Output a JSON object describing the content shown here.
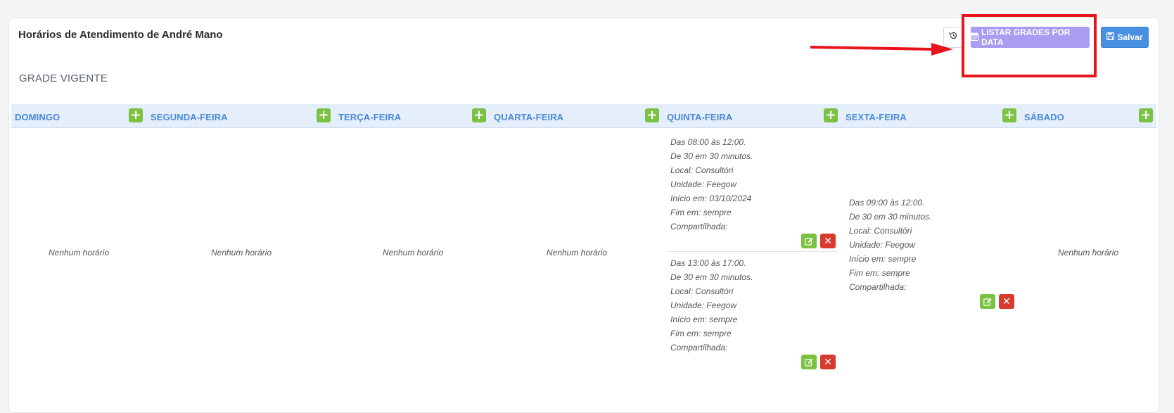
{
  "page": {
    "title": "Horários de Atendimento de André Mano",
    "section_title": "GRADE VIGENTE"
  },
  "toolbar": {
    "history_icon": "history-icon",
    "list_label": "LISTAR GRADES POR DATA",
    "list_icon": "calendar-icon",
    "save_label": "Salvar",
    "save_icon": "floppy-disk-icon"
  },
  "colors": {
    "list_button": "#a99cf2",
    "save_button": "#4a90e2",
    "add_button": "#7bc142",
    "delete_button": "#d93a2f",
    "header_bg": "#e5eefb",
    "day_label": "#4a8ad8",
    "annotation": "#e8141b"
  },
  "days": [
    {
      "label": "DOMINGO",
      "empty": "Nenhum horário"
    },
    {
      "label": "SEGUNDA-FEIRA",
      "empty": "Nenhum horário"
    },
    {
      "label": "TERÇA-FEIRA",
      "empty": "Nenhum horário"
    },
    {
      "label": "QUARTA-FEIRA",
      "empty": "Nenhum horário"
    },
    {
      "label": "QUINTA-FEIRA"
    },
    {
      "label": "SEXTA-FEIRA"
    },
    {
      "label": "SÁBADO",
      "empty": "Nenhum horário"
    }
  ],
  "thursday_slots": [
    {
      "time": "Das 08:00 às 12:00.",
      "interval": "De 30 em 30 minutos.",
      "local": "Local: Consultóri",
      "unit": "Unidade: Feegow",
      "start": "Início em: 03/10/2024",
      "end": "Fim em: sempre",
      "shared": "Compartilhada:"
    },
    {
      "time": "Das 13:00 às 17:00.",
      "interval": "De 30 em 30 minutos.",
      "local": "Local: Consultóri",
      "unit": "Unidade: Feegow",
      "start": "Início em: sempre",
      "end": "Fim em: sempre",
      "shared": "Compartilhada:"
    }
  ],
  "friday_slots": [
    {
      "time": "Das 09:00 às 12:00.",
      "interval": "De 30 em 30 minutos.",
      "local": "Local: Consultóri",
      "unit": "Unidade: Feegow",
      "start": "Início em: sempre",
      "end": "Fim em: sempre",
      "shared": "Compartilhada:"
    }
  ]
}
